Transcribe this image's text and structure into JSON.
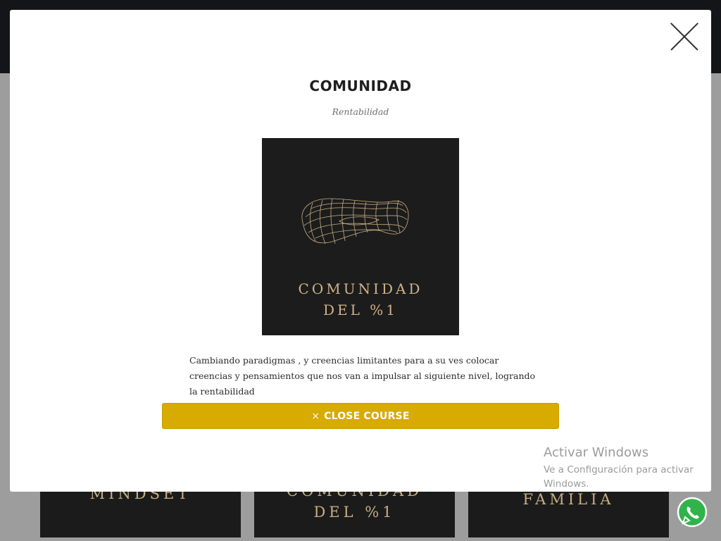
{
  "background": {
    "cards": [
      {
        "label": "MINDSET"
      },
      {
        "label": "COMUNIDAD\nDEL %1"
      },
      {
        "label": "FAMILIA"
      }
    ]
  },
  "modal": {
    "title": "COMUNIDAD",
    "subtitle": "Rentabilidad",
    "image": {
      "line1": "COMUNIDAD",
      "line2": "DEL %1"
    },
    "description": "Cambiando paradigmas , y creencias limitantes para a su ves colocar creencias y pensamientos que nos van a impulsar al siguiente nivel, logrando la rentabilidad",
    "close_course_label": "CLOSE COURSE",
    "close_course_icon": "×"
  },
  "watermark": {
    "title": "Activar Windows",
    "body": "Ve a Configuración para activar Windows."
  },
  "colors": {
    "accent": "#d8ab00",
    "header": "#141518",
    "gold_text": "#cfb38a"
  },
  "icons": {
    "close": "close-icon",
    "whatsapp": "whatsapp-icon",
    "wireframe": "wireframe-torus-icon"
  }
}
